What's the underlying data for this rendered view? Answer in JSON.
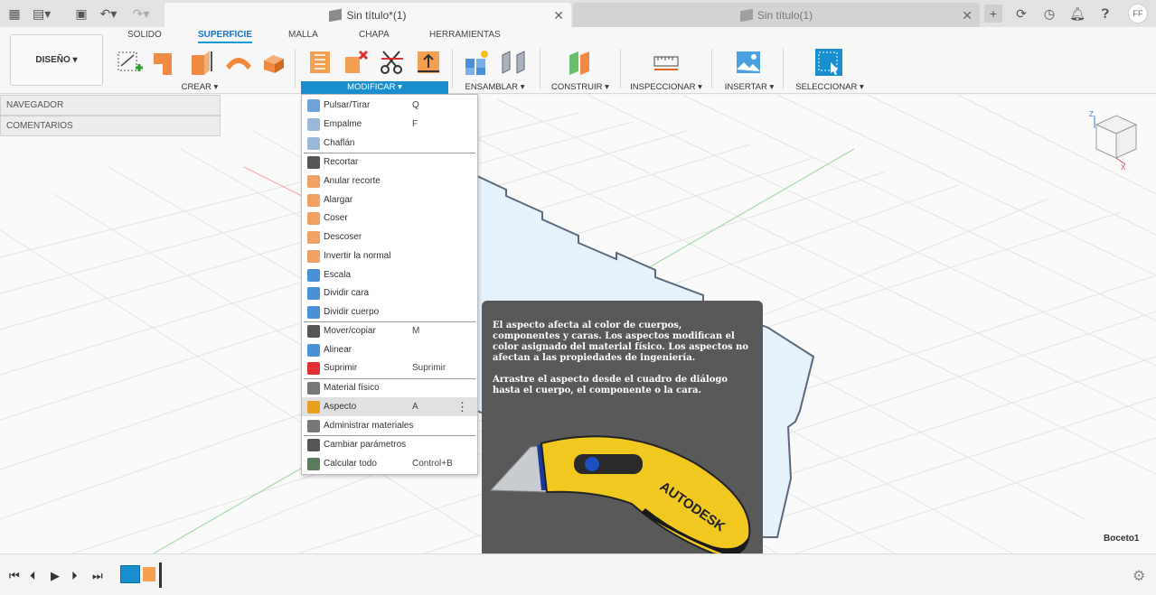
{
  "window": {
    "active_tab": "Sin título*(1)",
    "inactive_tab": "Sin título(1)",
    "user_initials": "FF"
  },
  "ribbon": {
    "workspace": "DISEÑO ▾",
    "tabs": [
      "SOLIDO",
      "SUPERFICIE",
      "MALLA",
      "CHAPA",
      "HERRAMIENTAS"
    ],
    "groups": {
      "crear": "CREAR ▾",
      "modificar": "MODIFICAR ▾",
      "ensamblar": "ENSAMBLAR ▾",
      "construir": "CONSTRUIR ▾",
      "inspeccionar": "INSPECCIONAR ▾",
      "insertar": "INSERTAR ▾",
      "seleccionar": "SELECCIONAR ▾"
    }
  },
  "browser": {
    "navegador": "NAVEGADOR",
    "comentarios": "COMENTARIOS"
  },
  "menu": {
    "items": [
      {
        "label": "Pulsar/Tirar",
        "shortcut": "Q",
        "color": "#6aa3d8"
      },
      {
        "label": "Empalme",
        "shortcut": "F",
        "color": "#9ab8d8"
      },
      {
        "label": "Chaflán",
        "shortcut": "",
        "color": "#9ab8d8"
      },
      {
        "label": "Recortar",
        "shortcut": "",
        "color": "#555555"
      },
      {
        "label": "Anular recorte",
        "shortcut": "",
        "color": "#f0a060"
      },
      {
        "label": "Alargar",
        "shortcut": "",
        "color": "#f0a060"
      },
      {
        "label": "Coser",
        "shortcut": "",
        "color": "#f0a060"
      },
      {
        "label": "Descoser",
        "shortcut": "",
        "color": "#f0a060"
      },
      {
        "label": "Invertir la normal",
        "shortcut": "",
        "color": "#f0a060"
      },
      {
        "label": "Escala",
        "shortcut": "",
        "color": "#4a90d9"
      },
      {
        "label": "Dividir cara",
        "shortcut": "",
        "color": "#4a90d9"
      },
      {
        "label": "Dividir cuerpo",
        "shortcut": "",
        "color": "#4a90d9"
      },
      {
        "label": "Mover/copiar",
        "shortcut": "M",
        "color": "#555555"
      },
      {
        "label": "Alinear",
        "shortcut": "",
        "color": "#4a90d9"
      },
      {
        "label": "Suprimir",
        "shortcut": "Suprimir",
        "color": "#e03030"
      },
      {
        "label": "Material físico",
        "shortcut": "",
        "color": "#777777"
      },
      {
        "label": "Aspecto",
        "shortcut": "A",
        "color": "#e8a020"
      },
      {
        "label": "Administrar materiales",
        "shortcut": "",
        "color": "#777777"
      },
      {
        "label": "Cambiar parámetros",
        "shortcut": "",
        "color": "#555555"
      },
      {
        "label": "Calcular todo",
        "shortcut": "Control+B",
        "color": "#5a7a5a"
      }
    ]
  },
  "tooltip": {
    "paragraph1": "El aspecto afecta al color de cuerpos, componentes y caras. Los aspectos modifican el color asignado del material físico. Los aspectos no afectan a las propiedades de ingeniería.",
    "paragraph2": "Arrastre el aspecto desde el cuadro de diálogo hasta el cuerpo, el componente o la cara.",
    "brand": "AUTODESK"
  },
  "viewport": {
    "sketch_label": "Boceto1",
    "viewcube_z": "Z",
    "viewcube_x": "X"
  }
}
